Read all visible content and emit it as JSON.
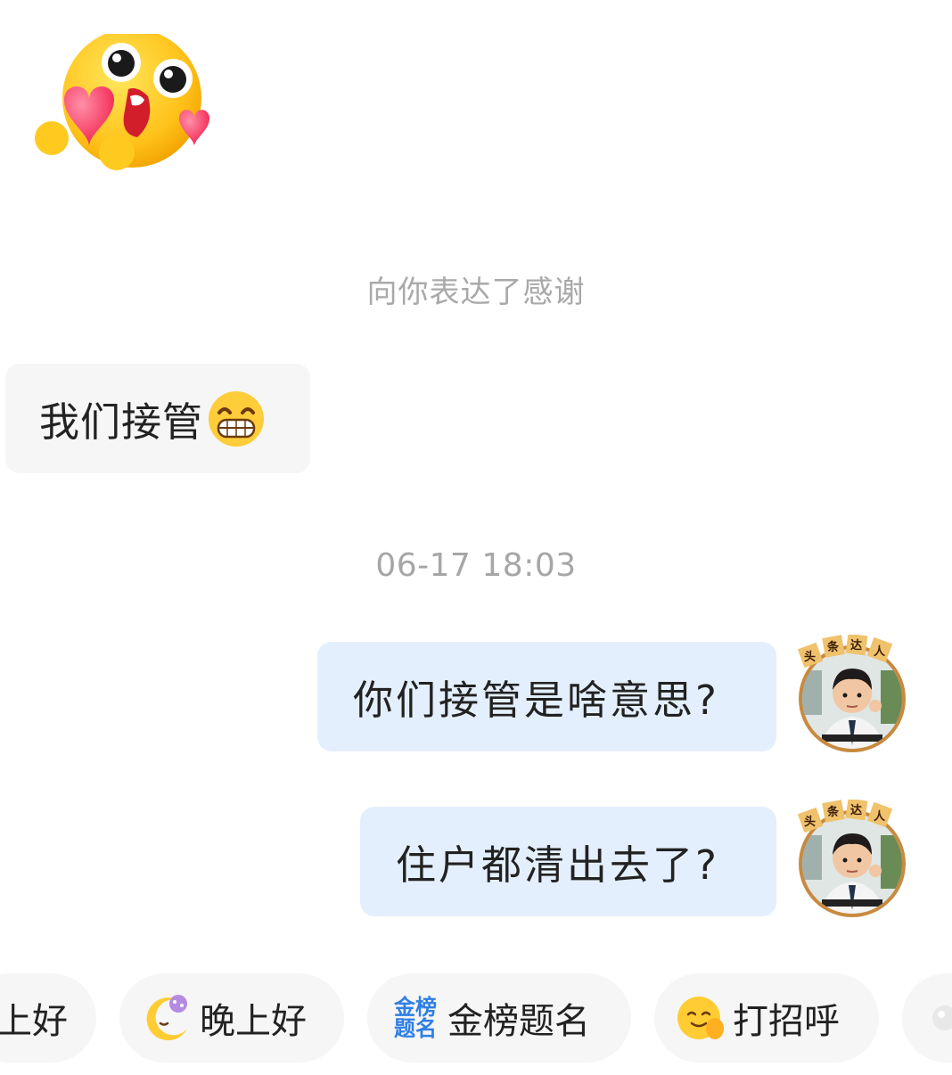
{
  "sticker": {
    "icon": "love-heart-face-sticker"
  },
  "system_notice": "向你表达了感谢",
  "messages": {
    "incoming": [
      {
        "text": "我们接管",
        "emoji": "grinning-face-icon"
      }
    ],
    "timestamp": "06-17 18:03",
    "outgoing": [
      {
        "text": "你们接管是啥意思?"
      },
      {
        "text": "住户都清出去了?"
      }
    ],
    "avatar_badge": [
      "头",
      "条",
      "达",
      "人"
    ]
  },
  "quick_replies": [
    {
      "label": "上好",
      "icon": ""
    },
    {
      "label": "晚上好",
      "icon": "moon-sleep-icon"
    },
    {
      "label": "金榜题名",
      "icon": "gold-list-icon",
      "icon_text": [
        "金榜",
        "题名"
      ]
    },
    {
      "label": "打招呼",
      "icon": "wave-hand-face-icon"
    },
    {
      "label": "",
      "icon": "partial-chip-icon"
    }
  ],
  "colors": {
    "incoming_bubble": "#f6f6f6",
    "outgoing_bubble": "#e4effd",
    "chip_background": "#f6f6f6",
    "muted_text": "#a9a9a9"
  }
}
